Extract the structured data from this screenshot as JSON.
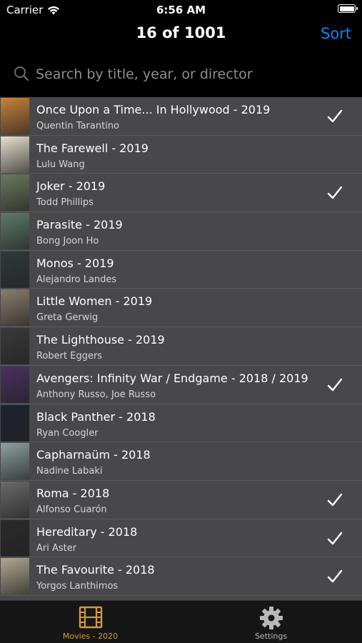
{
  "status_bar": {
    "carrier": "Carrier",
    "time": "6:56 AM"
  },
  "nav": {
    "title": "16 of 1001",
    "sort_label": "Sort"
  },
  "search": {
    "placeholder": "Search by title, year, or director",
    "value": ""
  },
  "movies": [
    {
      "title": "Once Upon a Time... In Hollywood - 2019",
      "director": "Quentin Tarantino",
      "checked": true,
      "poster_color": "#c9823a"
    },
    {
      "title": "The Farewell - 2019",
      "director": "Lulu Wang",
      "checked": false,
      "poster_color": "#e8e1d0"
    },
    {
      "title": "Joker - 2019",
      "director": "Todd Phillips",
      "checked": true,
      "poster_color": "#6b7a5e"
    },
    {
      "title": "Parasite - 2019",
      "director": "Bong Joon Ho",
      "checked": false,
      "poster_color": "#5e7a6a"
    },
    {
      "title": "Monos - 2019",
      "director": "Alejandro Landes",
      "checked": false,
      "poster_color": "#2f3a3a"
    },
    {
      "title": "Little Women - 2019",
      "director": "Greta Gerwig",
      "checked": false,
      "poster_color": "#8a7e6e"
    },
    {
      "title": "The Lighthouse - 2019",
      "director": "Robert Eggers",
      "checked": false,
      "poster_color": "#3a3a3a"
    },
    {
      "title": "Avengers: Infinity War / Endgame - 2018 / 2019",
      "director": "Anthony Russo, Joe Russo",
      "checked": true,
      "poster_color": "#4a3060"
    },
    {
      "title": "Black Panther - 2018",
      "director": "Ryan Coogler",
      "checked": false,
      "poster_color": "#1c2230"
    },
    {
      "title": "Capharnaüm - 2018",
      "director": "Nadine Labaki",
      "checked": false,
      "poster_color": "#8fa0a0"
    },
    {
      "title": "Roma - 2018",
      "director": "Alfonso Cuarón",
      "checked": true,
      "poster_color": "#6a6a6a"
    },
    {
      "title": "Hereditary - 2018",
      "director": "Ari Aster",
      "checked": true,
      "poster_color": "#2a2a2a"
    },
    {
      "title": "The Favourite - 2018",
      "director": "Yorgos Lanthimos",
      "checked": true,
      "poster_color": "#b0a890"
    }
  ],
  "tabs": {
    "movies_label": "Movies - 2020",
    "settings_label": "Settings"
  },
  "colors": {
    "accent_blue": "#0a84ff",
    "tab_active": "#d4993a",
    "list_background": "#48484a"
  },
  "icons": {
    "wifi": "wifi-icon",
    "battery": "battery-icon",
    "search": "search-icon",
    "check": "checkmark-icon",
    "film": "film-strip-icon",
    "gear": "gear-icon"
  }
}
